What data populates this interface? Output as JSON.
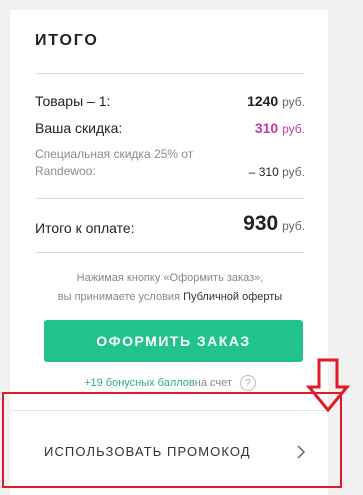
{
  "summary": {
    "title": "ИТОГО",
    "goods_label": "Товары – 1:",
    "goods_value": "1240",
    "discount_label": "Ваша скидка:",
    "discount_value": "310",
    "special_label_line1": "Специальная скидка 25% от",
    "special_label_line2": "Randewoo:",
    "special_value": "– 310",
    "total_label": "Итого к оплате:",
    "total_value": "930",
    "currency": "руб."
  },
  "notice": {
    "line1": "Нажимая кнопку «Оформить заказ»,",
    "line2_prefix": "вы принимаете условия ",
    "line2_link": "Публичной оферты"
  },
  "order_button": {
    "label": "ОФОРМИТЬ ЗАКАЗ"
  },
  "bonus": {
    "green_text": "+19 бонусных баллов",
    "tail_text": " на счет",
    "help_icon": "?"
  },
  "promo": {
    "label": "ИСПОЛЬЗОВАТЬ ПРОМОКОД"
  },
  "colors": {
    "accent_green": "#22c38a",
    "discount_pink": "#c23aa8",
    "highlight_red": "#e11b2a"
  }
}
